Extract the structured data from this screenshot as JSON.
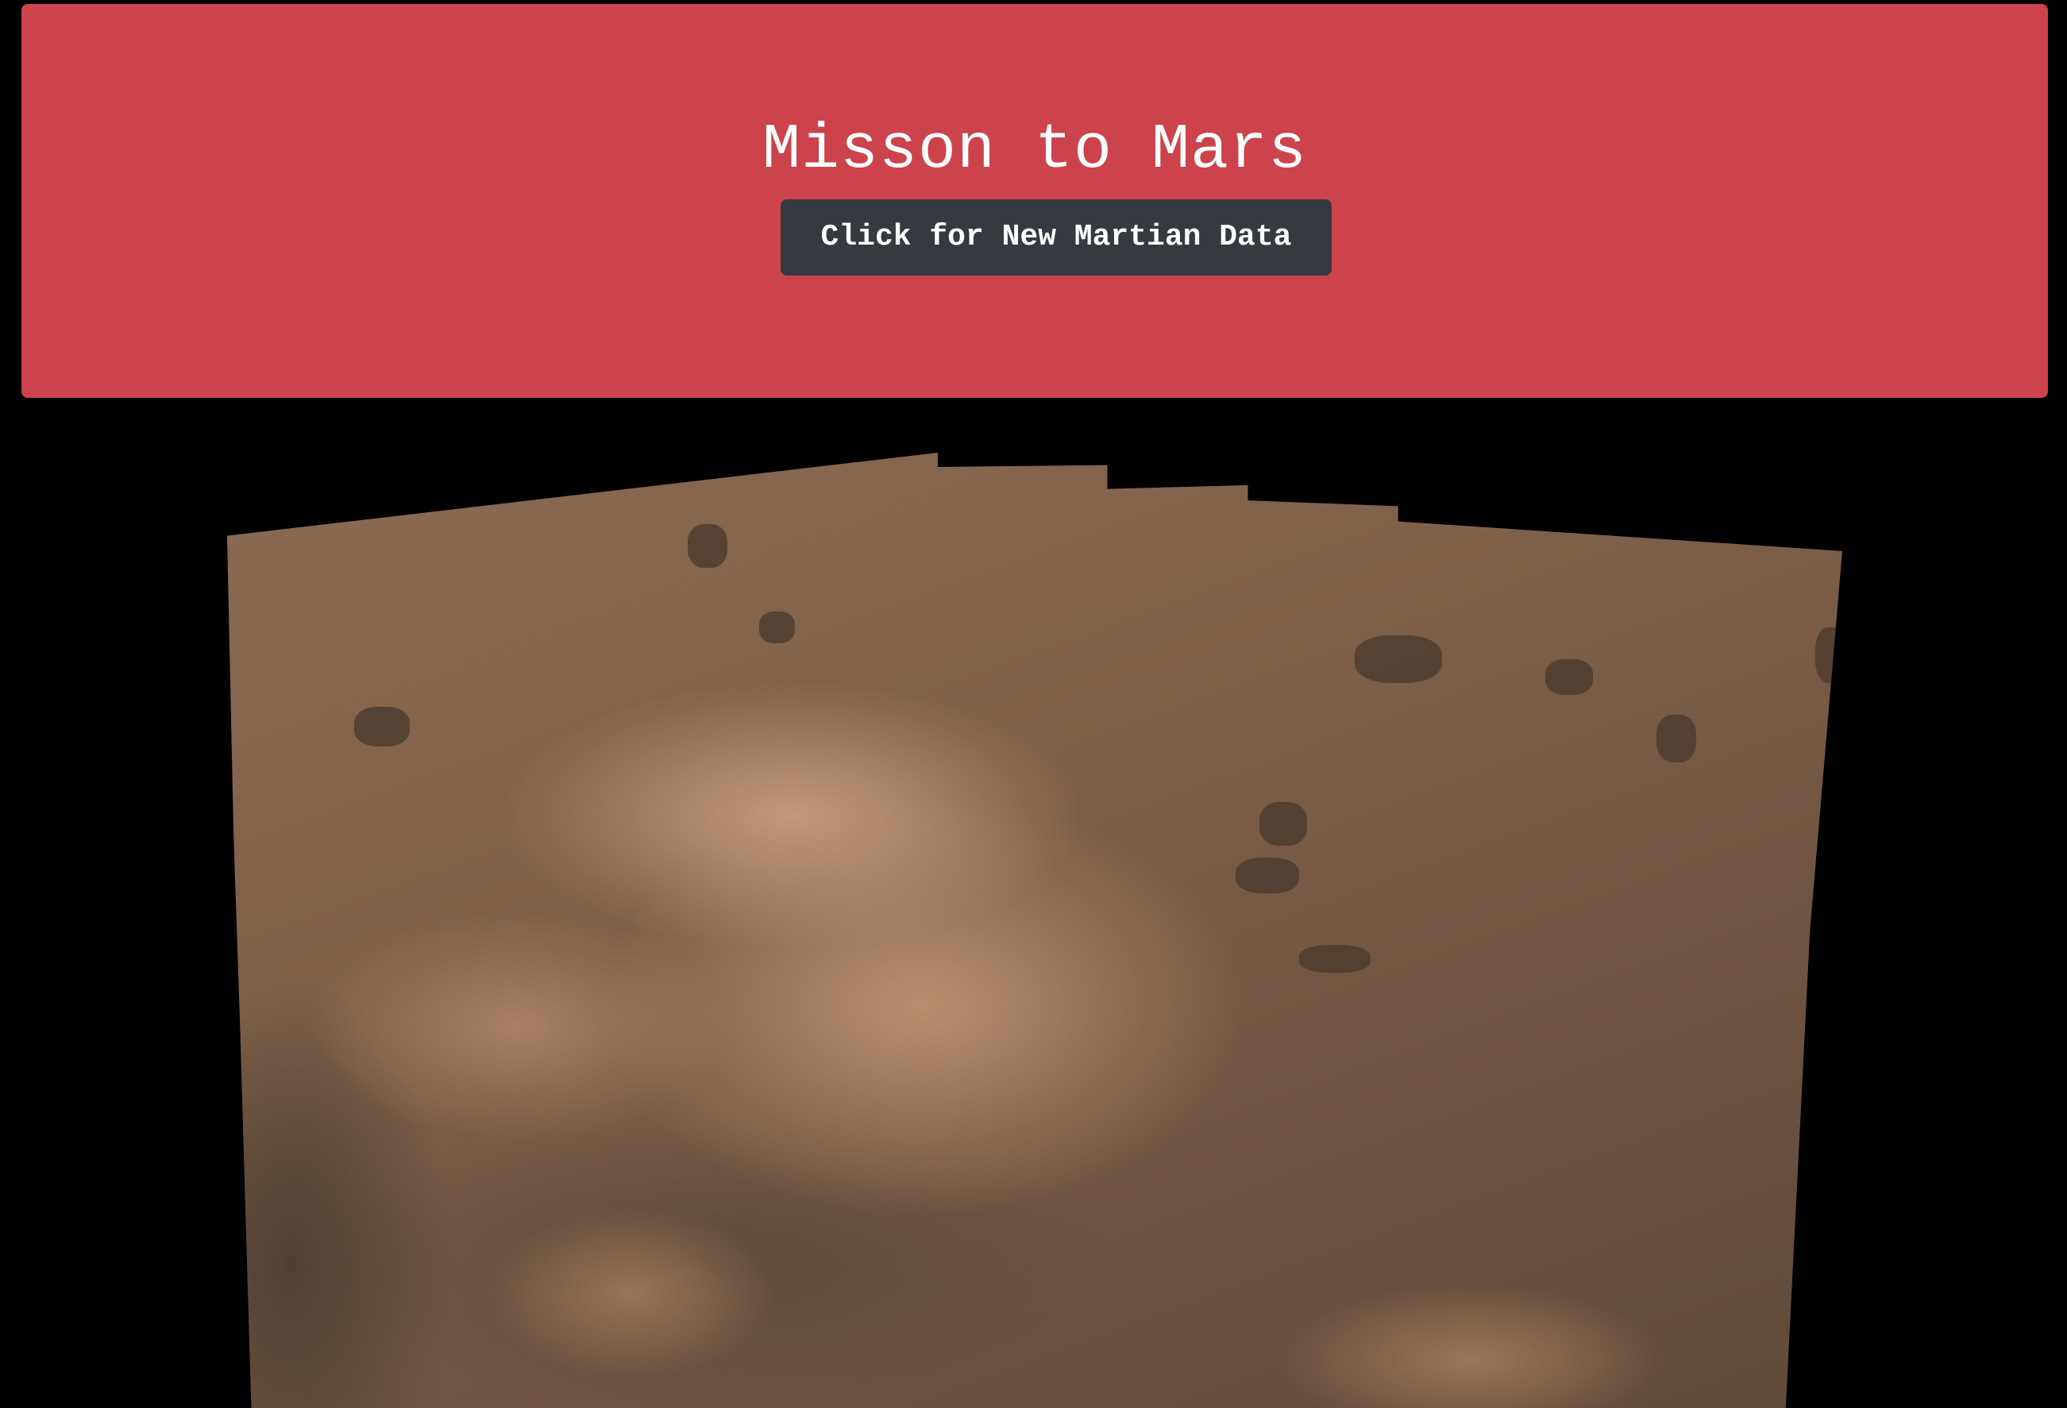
{
  "header": {
    "title": "Misson to Mars",
    "scrape_button_label": "Click for New Martian Data"
  },
  "featured_image": {
    "alt": "Mars surface featured image",
    "icon": "mars-surface-photo"
  },
  "colors": {
    "jumbotron_background": "#cd434c",
    "button_background": "#343a40",
    "page_background": "#000000",
    "text": "#ffffff"
  }
}
